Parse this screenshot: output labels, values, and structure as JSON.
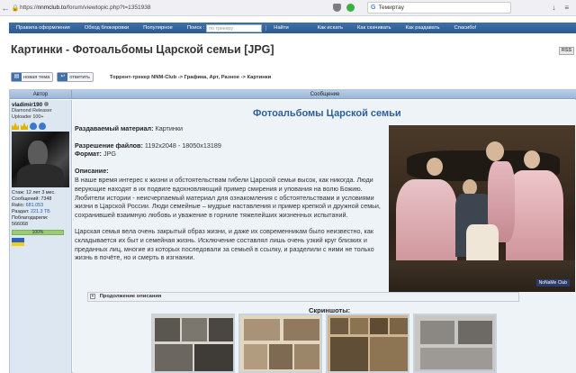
{
  "browser": {
    "url_prefix": "https://",
    "url_host": "nnmclub.to",
    "url_path": "/forum/viewtopic.php?t=1351938",
    "search_text": "Темиртау"
  },
  "site_nav": {
    "items": [
      "Правила оформления",
      "Обход блокировки",
      "Популярное"
    ],
    "search_label": "Поиск :",
    "search_placeholder": "по трекеру",
    "search_button": "Найти",
    "right_items": [
      "Как искать",
      "Как скачивать",
      "Как раздавать",
      "Спасибо!"
    ]
  },
  "page": {
    "title": "Картинки - Фотоальбомы Царской семьи [JPG]",
    "rss": "RSS",
    "new_topic": "новая тема",
    "reply": "ответить",
    "breadcrumb": "Торрент-трекер NNM-Club -> Графика, Арт, Разное -> Картинки"
  },
  "table": {
    "author_header": "Автор",
    "message_header": "Сообщение"
  },
  "author": {
    "name": "vladimir190",
    "rank_line1": "Diamond Releaser",
    "rank_line2": "Uploader 100+",
    "stats": [
      {
        "label": "Стаж:",
        "value": "12 лет 3 мес."
      },
      {
        "label": "Сообщений:",
        "value": "7348"
      },
      {
        "label": "Ratio:",
        "value": "681.053"
      },
      {
        "label": "Раздал:",
        "value": "221.3 ТБ"
      },
      {
        "label": "Поблагодарили:",
        "value": "566068"
      }
    ],
    "ratio_percent": "100%"
  },
  "post": {
    "heading": "Фотоальбомы Царской семьи",
    "material_label": "Раздаваемый материал:",
    "material_value": "Картинки",
    "resolution_label": "Разрешение файлов:",
    "resolution_value": "1192x2048 - 18050x13189",
    "format_label": "Формат:",
    "format_value": "JPG",
    "description_label": "Описание:",
    "paragraph1": "В наше время интерес к жизни и обстоятельствам гибели Царской семьи высок, как никогда. Люди верующие находят в их подвиге вдохновляющий пример смирения и упования на волю Божию. Любители истории - неисчерпаемый материал для ознакомления с обстоятельствами и условиями жизни в Царской России. Люди семейные – мудрые наставления и пример крепкой и дружной семьи, сохранившей взаимную любовь и уважение в горниле тяжелейших жизненных испытаний.",
    "paragraph2": "Царская семья вела очень закрытый образ жизни, и даже их современникам было неизвестно, как складывается их быт и семейная жизнь. Исключение составлял лишь очень узкий круг близких и преданных лиц, многие из которых последовали за семьей в ссылку, и разделили с ними не только жизнь в почёте, но и смерть в изгнании.",
    "watermark": "NoNaMe Club",
    "spoiler_label": "Продолжение описания",
    "screenshots_label": "Скриншоты:"
  }
}
